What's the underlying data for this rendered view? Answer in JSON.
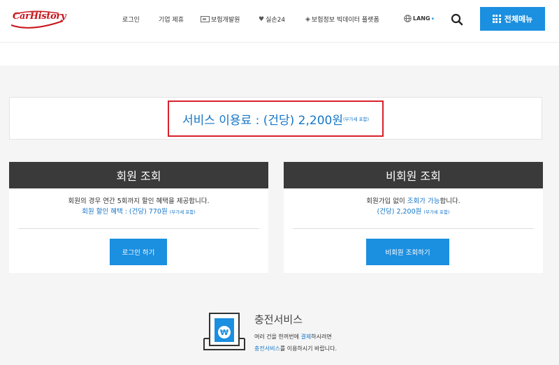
{
  "header": {
    "logo": "CarHistory",
    "nav": [
      {
        "label": "로그인",
        "icon": ""
      },
      {
        "label": "기업 제휴",
        "icon": ""
      },
      {
        "label": "보험개발원",
        "icon": "institute-logo-icon"
      },
      {
        "label": "실손24",
        "icon": "heart-icon"
      },
      {
        "label": "보험정보 빅데이터 플랫폼",
        "icon": "cube-icon"
      },
      {
        "label": "LANG",
        "icon": "globe-icon"
      }
    ],
    "menu_label": "전체메뉴"
  },
  "price": {
    "main": "서비스 이용료 : (건당) 2,200원",
    "note": "(부가세 포함)"
  },
  "member_card": {
    "title": "회원 조회",
    "line1": "회원의 경우 연간 5회까지 할인 혜택을 제공합니다.",
    "line2": "회원 할인 혜택 : (건당) 770원",
    "note": "(부가세 포함)",
    "button": "로그인 하기"
  },
  "nonmember_card": {
    "title": "비회원 조회",
    "line1_a": "회원가입 없이 ",
    "line1_b": "조회가 가능",
    "line1_c": "합니다.",
    "line2": "(건당) 2,200원",
    "note": "(부가세 포함)",
    "button": "비회원 조회하기"
  },
  "charge": {
    "title": "충전서비스",
    "line1_a": "여러 건을 한꺼번에 ",
    "line1_b": "결제",
    "line1_c": "하시려면",
    "line2_a": "충전서비스",
    "line2_b": "를 이용하시기 바랍니다."
  },
  "colors": {
    "accent": "#1b8fe0",
    "link": "#1676c7",
    "highlight_border": "#d8202b",
    "card_header": "#3a3a3a"
  }
}
